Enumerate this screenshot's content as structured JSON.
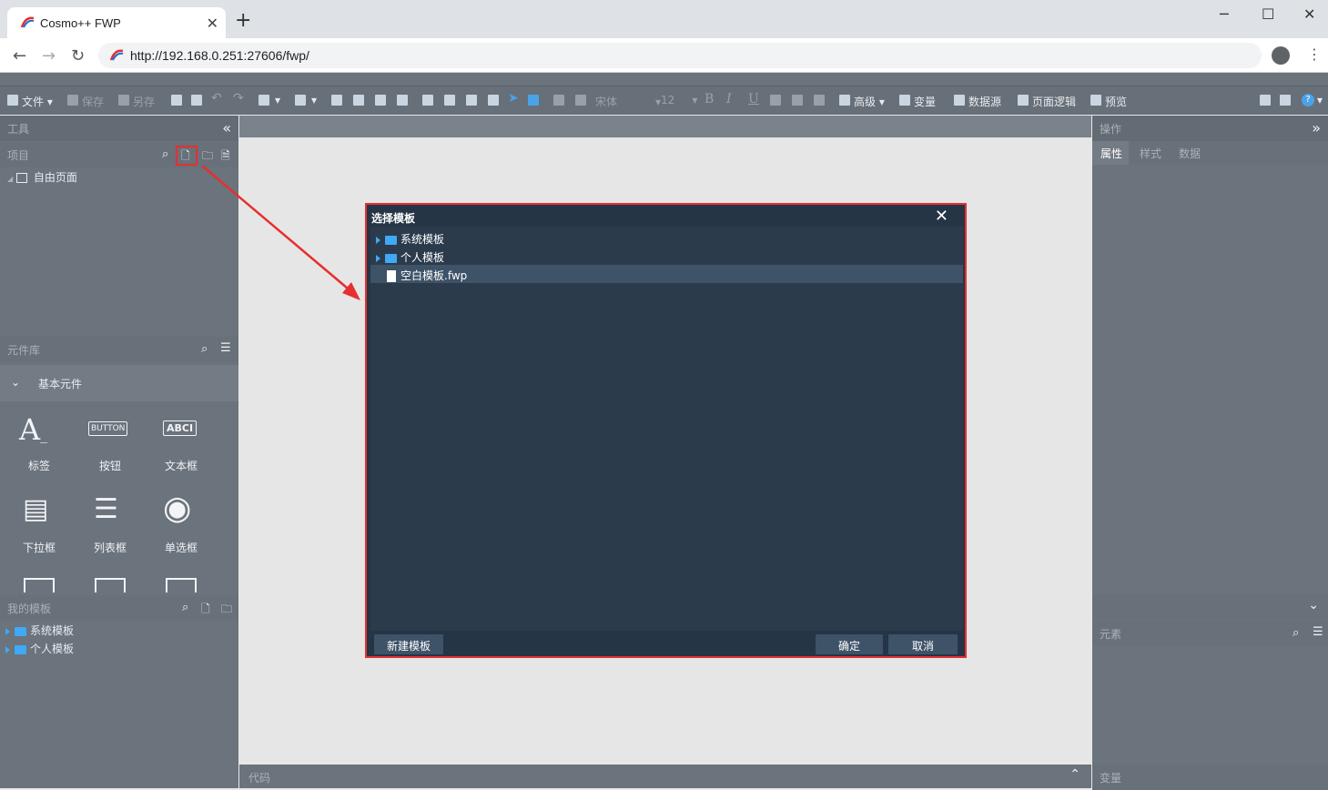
{
  "browser": {
    "tab_title": "Cosmo++ FWP",
    "tab_close": "✕",
    "new_tab": "+",
    "url": "http://192.168.0.251:27606/fwp/"
  },
  "toolbar": {
    "file": "文件",
    "save": "保存",
    "save_as": "另存",
    "font_name": "宋体",
    "font_size": "12",
    "bold": "B",
    "italic": "I",
    "underline": "U",
    "advanced": "高级",
    "variable": "变量",
    "datasource": "数据源",
    "page_logic": "页面逻辑",
    "preview": "预览"
  },
  "left": {
    "tools_title": "工具",
    "project_title": "项目",
    "project_tree": [
      "自由页面"
    ],
    "library_title": "元件库",
    "basic_group": "基本元件",
    "components": [
      {
        "label": "标签",
        "glyph": "A_"
      },
      {
        "label": "按钮",
        "glyph": "BUTTON"
      },
      {
        "label": "文本框",
        "glyph": "ABCI"
      },
      {
        "label": "下拉框",
        "glyph": "▤"
      },
      {
        "label": "列表框",
        "glyph": "☰"
      },
      {
        "label": "单选框",
        "glyph": "◉"
      }
    ],
    "my_templates_title": "我的模板",
    "templates": [
      "系统模板",
      "个人模板"
    ]
  },
  "right": {
    "ops_title": "操作",
    "tabs": [
      "属性",
      "样式",
      "数据"
    ],
    "elements_title": "元素",
    "variables_title": "变量"
  },
  "bottom": {
    "code_title": "代码"
  },
  "modal": {
    "title": "选择模板",
    "items": [
      {
        "label": "系统模板",
        "type": "folder"
      },
      {
        "label": "个人模板",
        "type": "folder"
      },
      {
        "label": "空白模板.fwp",
        "type": "file",
        "selected": true
      }
    ],
    "new_template": "新建模板",
    "ok": "确定",
    "cancel": "取消"
  },
  "colors": {
    "panel_bg": "#6b737c",
    "modal_bg": "#263545",
    "highlight_red": "#e5302f",
    "folder_blue": "#3fa9f5"
  }
}
